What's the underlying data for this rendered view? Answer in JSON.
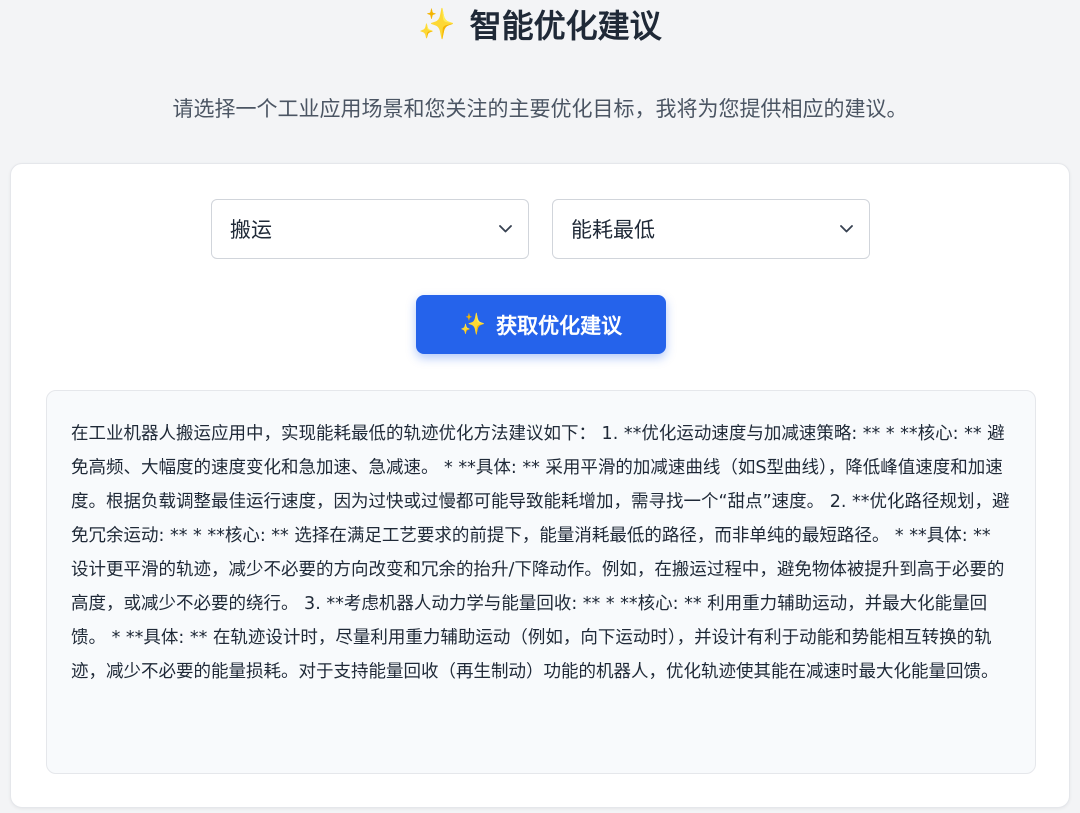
{
  "header": {
    "icon": "sparkles-icon",
    "title": "智能优化建议",
    "subtitle": "请选择一个工业应用场景和您关注的主要优化目标，我将为您提供相应的建议。"
  },
  "form": {
    "scenario_value": "搬运",
    "goal_value": "能耗最低",
    "submit_label": "获取优化建议"
  },
  "result": {
    "text": "在工业机器人搬运应用中，实现能耗最低的轨迹优化方法建议如下： 1. **优化运动速度与加减速策略: ** * **核心: ** 避免高频、大幅度的速度变化和急加速、急减速。 * **具体: ** 采用平滑的加减速曲线（如S型曲线），降低峰值速度和加速度。根据负载调整最佳运行速度，因为过快或过慢都可能导致能耗增加，需寻找一个“甜点”速度。 2. **优化路径规划，避免冗余运动: ** * **核心: ** 选择在满足工艺要求的前提下，能量消耗最低的路径，而非单纯的最短路径。 * **具体: ** 设计更平滑的轨迹，减少不必要的方向改变和冗余的抬升/下降动作。例如，在搬运过程中，避免物体被提升到高于必要的高度，或减少不必要的绕行。 3. **考虑机器人动力学与能量回收: ** * **核心: ** 利用重力辅助运动，并最大化能量回馈。 * **具体: ** 在轨迹设计时，尽量利用重力辅助运动（例如，向下运动时），并设计有利于动能和势能相互转换的轨迹，减少不必要的能量损耗。对于支持能量回收（再生制动）功能的机器人，优化轨迹使其能在减速时最大化能量回馈。"
  },
  "colors": {
    "background": "#f3f4f6",
    "accent": "#2563eb",
    "spark": "#fbbf24"
  }
}
